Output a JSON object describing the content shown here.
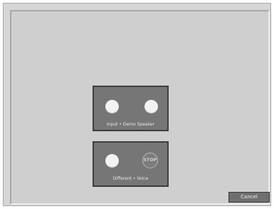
{
  "panels": [
    {
      "label": "Input • Demo Speaker",
      "controls": [
        "record-indicator",
        "play-indicator"
      ]
    },
    {
      "label": "Different • Voice",
      "controls": [
        "record-indicator",
        "stop-button"
      ]
    }
  ],
  "stop_label": "STOP",
  "cancel_label": "Cancel",
  "colors": {
    "background": "#cfcfcf",
    "panel": "#767676",
    "panel_border": "#3e3e3e",
    "indicator": "#f3f3f3",
    "button": "#6f6f6f"
  }
}
